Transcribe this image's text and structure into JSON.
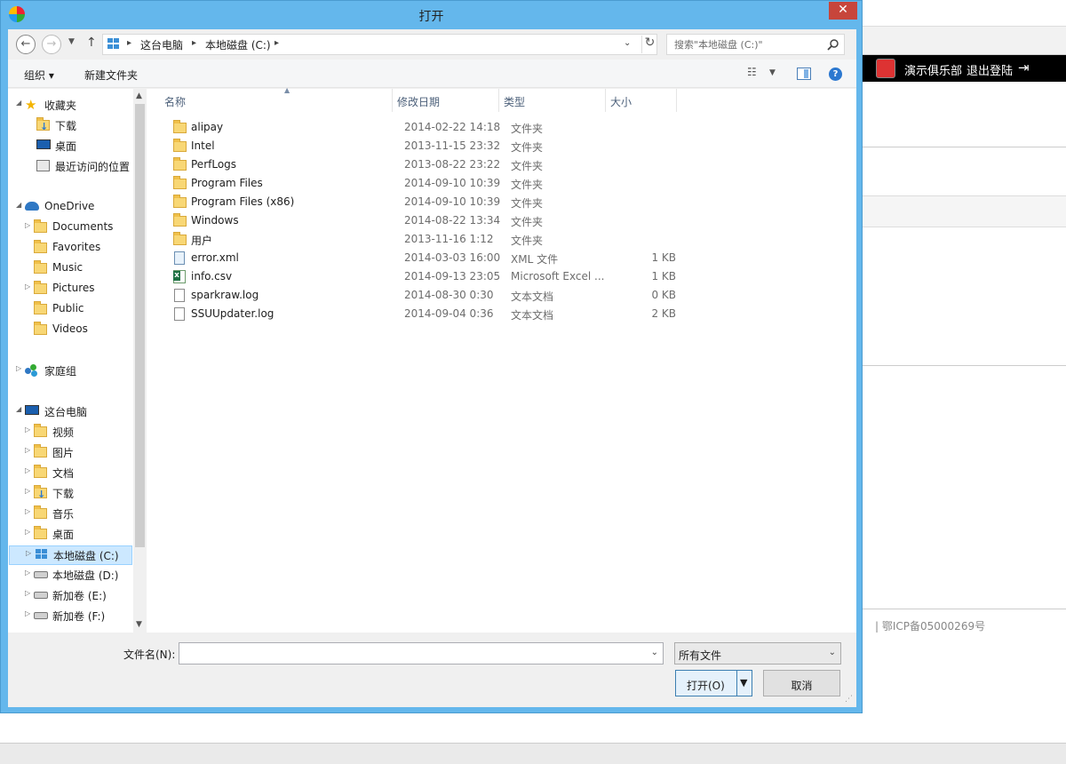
{
  "background": {
    "club_label": "演示俱乐部",
    "logout_label": "退出登陆",
    "icp": "|   鄂ICP备05000269号"
  },
  "dialog": {
    "title": "打开",
    "close_icon": "close-icon"
  },
  "address": {
    "crumbs": [
      "这台电脑",
      "本地磁盘 (C:)"
    ],
    "search_placeholder": "搜索\"本地磁盘 (C:)\""
  },
  "toolbar": {
    "organize_label": "组织 ▾",
    "new_folder_label": "新建文件夹"
  },
  "nav": {
    "favorites": {
      "label": "收藏夹",
      "items": [
        "下载",
        "桌面",
        "最近访问的位置"
      ]
    },
    "onedrive": {
      "label": "OneDrive",
      "items": [
        "Documents",
        "Favorites",
        "Music",
        "Pictures",
        "Public",
        "Videos"
      ]
    },
    "homegroup": {
      "label": "家庭组"
    },
    "thispc": {
      "label": "这台电脑",
      "items": [
        "视频",
        "图片",
        "文档",
        "下载",
        "音乐",
        "桌面",
        "本地磁盘 (C:)",
        "本地磁盘 (D:)",
        "新加卷 (E:)",
        "新加卷 (F:)"
      ]
    }
  },
  "columns": {
    "name": "名称",
    "date": "修改日期",
    "type": "类型",
    "size": "大小"
  },
  "files": [
    {
      "name": "alipay",
      "date": "2014-02-22 14:18",
      "type": "文件夹",
      "size": "",
      "kind": "folder"
    },
    {
      "name": "Intel",
      "date": "2013-11-15 23:32",
      "type": "文件夹",
      "size": "",
      "kind": "folder"
    },
    {
      "name": "PerfLogs",
      "date": "2013-08-22 23:22",
      "type": "文件夹",
      "size": "",
      "kind": "folder"
    },
    {
      "name": "Program Files",
      "date": "2014-09-10 10:39",
      "type": "文件夹",
      "size": "",
      "kind": "folder"
    },
    {
      "name": "Program Files (x86)",
      "date": "2014-09-10 10:39",
      "type": "文件夹",
      "size": "",
      "kind": "folder"
    },
    {
      "name": "Windows",
      "date": "2014-08-22 13:34",
      "type": "文件夹",
      "size": "",
      "kind": "folder"
    },
    {
      "name": "用户",
      "date": "2013-11-16 1:12",
      "type": "文件夹",
      "size": "",
      "kind": "folder"
    },
    {
      "name": "error.xml",
      "date": "2014-03-03 16:00",
      "type": "XML 文件",
      "size": "1 KB",
      "kind": "xml"
    },
    {
      "name": "info.csv",
      "date": "2014-09-13 23:05",
      "type": "Microsoft Excel ...",
      "size": "1 KB",
      "kind": "excel"
    },
    {
      "name": "sparkraw.log",
      "date": "2014-08-30 0:30",
      "type": "文本文档",
      "size": "0 KB",
      "kind": "text"
    },
    {
      "name": "SSUUpdater.log",
      "date": "2014-09-04 0:36",
      "type": "文本文档",
      "size": "2 KB",
      "kind": "text"
    }
  ],
  "bottom": {
    "filename_label": "文件名(N):",
    "filename_value": "",
    "filetype_value": "所有文件",
    "open_label": "打开(O)",
    "cancel_label": "取消"
  },
  "colors": {
    "title_bar": "#64b7ec",
    "close_button": "#c7453b",
    "selection": "#cce8ff"
  }
}
